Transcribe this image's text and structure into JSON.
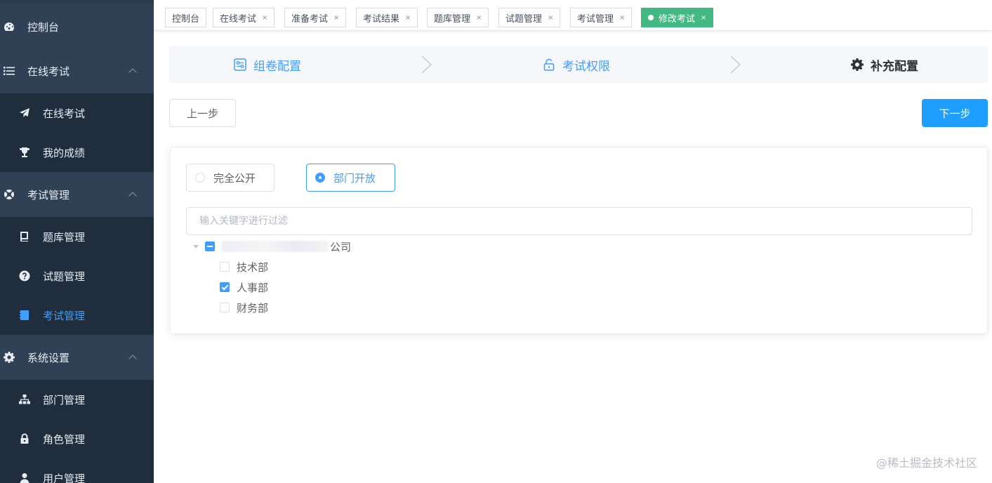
{
  "sidebar": {
    "items": [
      {
        "label": "控制台",
        "icon": "dashboard-icon"
      },
      {
        "label": "在线考试",
        "icon": "list-icon"
      },
      {
        "label": "在线考试",
        "icon": "paper-plane-icon"
      },
      {
        "label": "我的成绩",
        "icon": "trophy-icon"
      },
      {
        "label": "考试管理",
        "icon": "life-ring-icon"
      },
      {
        "label": "题库管理",
        "icon": "book-icon"
      },
      {
        "label": "试题管理",
        "icon": "question-circle-icon"
      },
      {
        "label": "考试管理",
        "icon": "notebook-icon"
      },
      {
        "label": "系统设置",
        "icon": "gear-icon"
      },
      {
        "label": "部门管理",
        "icon": "sitemap-icon"
      },
      {
        "label": "角色管理",
        "icon": "lock-icon"
      },
      {
        "label": "用户管理",
        "icon": "user-icon"
      }
    ],
    "active_color": "#409eff"
  },
  "tags": [
    {
      "label": "控制台"
    },
    {
      "label": "在线考试",
      "close": "×"
    },
    {
      "label": "准备考试",
      "close": "×"
    },
    {
      "label": "考试结果",
      "close": "×"
    },
    {
      "label": "题库管理",
      "close": "×"
    },
    {
      "label": "试题管理",
      "close": "×"
    },
    {
      "label": "考试管理",
      "close": "×"
    },
    {
      "label": "修改考试",
      "close": "×"
    }
  ],
  "steps": [
    {
      "label": "组卷配置",
      "icon": "paper-config-icon"
    },
    {
      "label": "考试权限",
      "icon": "unlock-icon"
    },
    {
      "label": "补充配置",
      "icon": "gear-icon"
    }
  ],
  "buttons": {
    "prev": "上一步",
    "next": "下一步"
  },
  "scope": {
    "options": [
      {
        "label": "完全公开",
        "checked": false
      },
      {
        "label": "部门开放",
        "checked": true
      }
    ]
  },
  "filter": {
    "placeholder": "输入关键字进行过滤"
  },
  "tree": {
    "root": {
      "label": "公司",
      "state": "indeterminate"
    },
    "children": [
      {
        "label": "技术部",
        "checked": false
      },
      {
        "label": "人事部",
        "checked": true
      },
      {
        "label": "财务部",
        "checked": false
      }
    ]
  },
  "watermark": "@稀土掘金技术社区",
  "colors": {
    "accent": "#409eff",
    "tag_active": "#42b983",
    "sidebar_bg": "#304156",
    "next_button": "#1e9fff"
  }
}
